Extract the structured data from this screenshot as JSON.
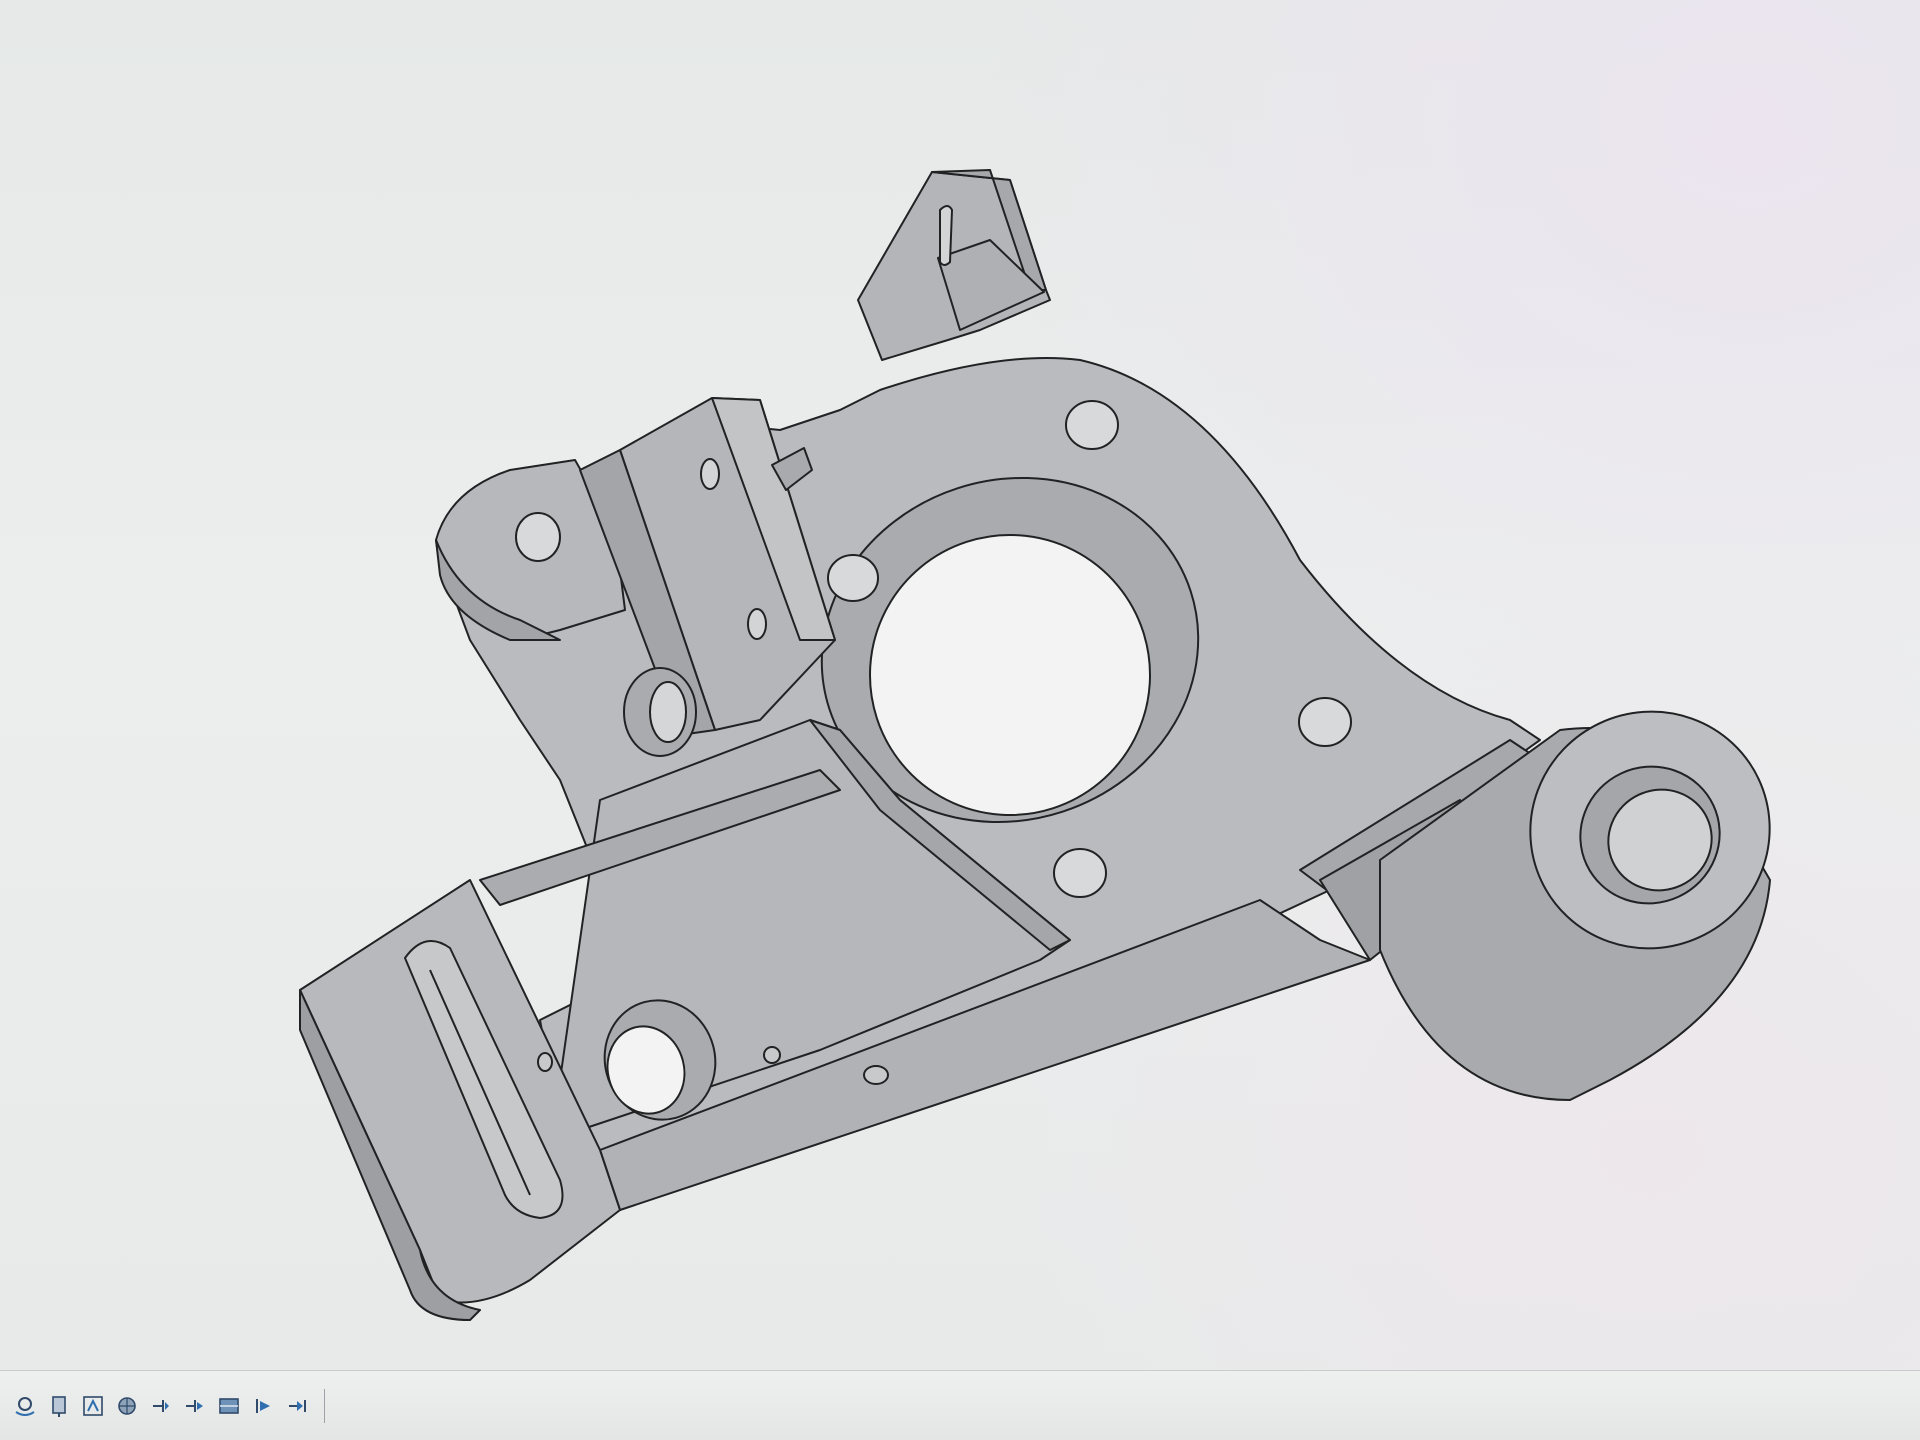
{
  "app": {
    "accent": "#2f6fb0"
  },
  "viewport": {
    "model_fill": "#b9bbbe",
    "model_shadow": "#9a9c9f",
    "model_edge": "#202223",
    "background": "#e9ebea"
  },
  "toolbar": {
    "buttons": [
      {
        "id": "orbit",
        "icon": "orbit-icon"
      },
      {
        "id": "look-at",
        "icon": "look-at-icon"
      },
      {
        "id": "zoom-window",
        "icon": "zoom-window-icon"
      },
      {
        "id": "display-settings",
        "icon": "display-settings-icon"
      },
      {
        "id": "timeline-first",
        "icon": "timeline-first-icon"
      },
      {
        "id": "timeline-prev",
        "icon": "timeline-prev-icon"
      },
      {
        "id": "view-cube",
        "icon": "view-cube-icon"
      },
      {
        "id": "timeline-play",
        "icon": "timeline-play-icon"
      },
      {
        "id": "timeline-last",
        "icon": "timeline-last-icon"
      }
    ]
  }
}
